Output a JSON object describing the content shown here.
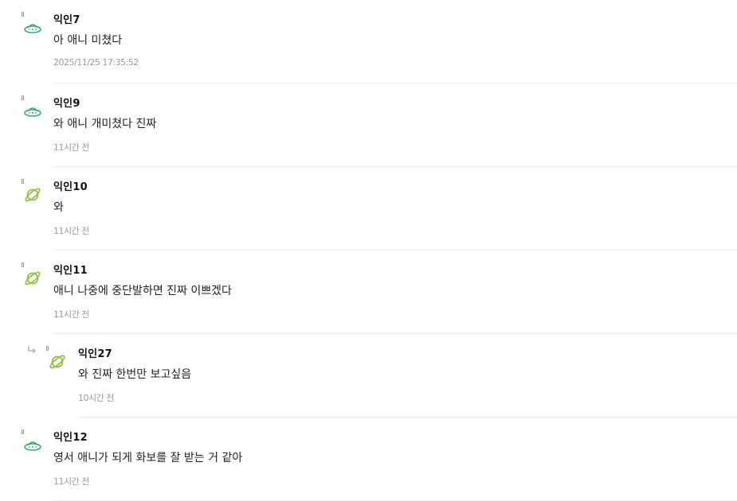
{
  "colors": {
    "ufo": "#2fae6b",
    "planet": "#8bc23c",
    "divider": "#ececec",
    "meta": "#9a9a9a"
  },
  "comments": [
    {
      "author": "익인7",
      "text": "아 애니 미쳤다",
      "time": "2025/11/25 17:35:52",
      "avatar_icon": "ufo-icon"
    },
    {
      "author": "익인9",
      "text": "와 애니 개미쳤다 진짜",
      "time": "11시간 전",
      "avatar_icon": "ufo-icon"
    },
    {
      "author": "익인10",
      "text": "와",
      "time": "11시간 전",
      "avatar_icon": "planet-icon"
    },
    {
      "author": "익인11",
      "text": "애니 나중에 중단발하면 진짜 이쁘겠다",
      "time": "11시간 전",
      "avatar_icon": "planet-icon"
    },
    {
      "author": "익인27",
      "text": "와 진짜 한번만 보고싶음",
      "time": "10시간 전",
      "avatar_icon": "planet-icon",
      "is_reply": true
    },
    {
      "author": "익인12",
      "text": "영서 애니가 되게 화보를 잘 받는 거 같아",
      "time": "11시간 전",
      "avatar_icon": "ufo-icon"
    }
  ]
}
